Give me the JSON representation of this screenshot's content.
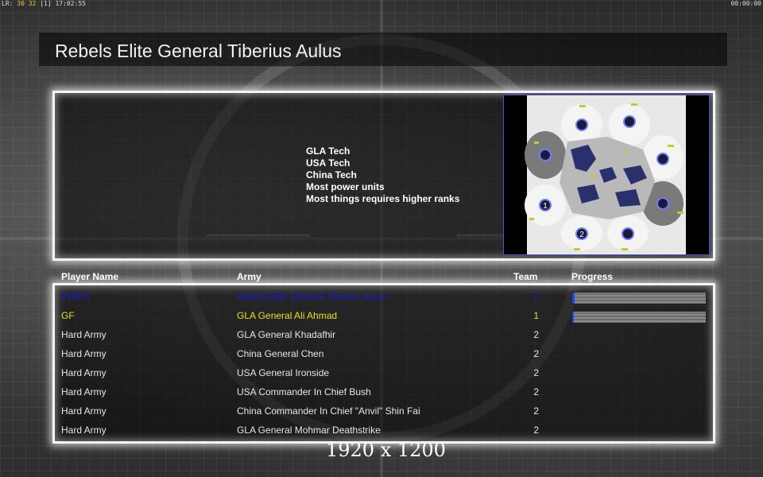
{
  "status_bar": {
    "left_prefix": "LR:",
    "left_values": "30 32",
    "left_suffix": "[1] 17:02:55",
    "right": "00:00:00"
  },
  "title": "Rebels Elite General Tiberius Aulus",
  "description": [
    "GLA Tech",
    "USA Tech",
    "China Tech",
    "Most power units",
    "Most things requires higher ranks"
  ],
  "minimap": {
    "player_start_labels": [
      "1",
      "2"
    ]
  },
  "headers": {
    "player_name": "Player Name",
    "army": "Army",
    "team": "Team",
    "progress": "Progress"
  },
  "players": [
    {
      "name": "PHIPS",
      "army": "Rebels Elite General Tiberius Aulus",
      "team": "1",
      "color": "#1a1ad8",
      "progress": 0.02,
      "bar_color": "#2244ee"
    },
    {
      "name": "GF",
      "army": "GLA General Ali Ahmad",
      "team": "1",
      "color": "#e8e020",
      "progress": 0.01,
      "bar_color": "#2244ee"
    },
    {
      "name": "Hard Army",
      "army": "GLA General Khadafhir",
      "team": "2",
      "color": "#e6e6e6"
    },
    {
      "name": "Hard Army",
      "army": "China General Chen",
      "team": "2",
      "color": "#e6e6e6"
    },
    {
      "name": "Hard Army",
      "army": "USA General Ironside",
      "team": "2",
      "color": "#e6e6e6"
    },
    {
      "name": "Hard Army",
      "army": "USA Commander In Chief Bush",
      "team": "2",
      "color": "#e6e6e6"
    },
    {
      "name": "Hard Army",
      "army": "China Commander In Chief \"Anvil\" Shin Fai",
      "team": "2",
      "color": "#e6e6e6"
    },
    {
      "name": "Hard Army",
      "army": "GLA General Mohmar Deathstrike",
      "team": "2",
      "color": "#e6e6e6"
    }
  ],
  "caption": "1920 x 1200"
}
